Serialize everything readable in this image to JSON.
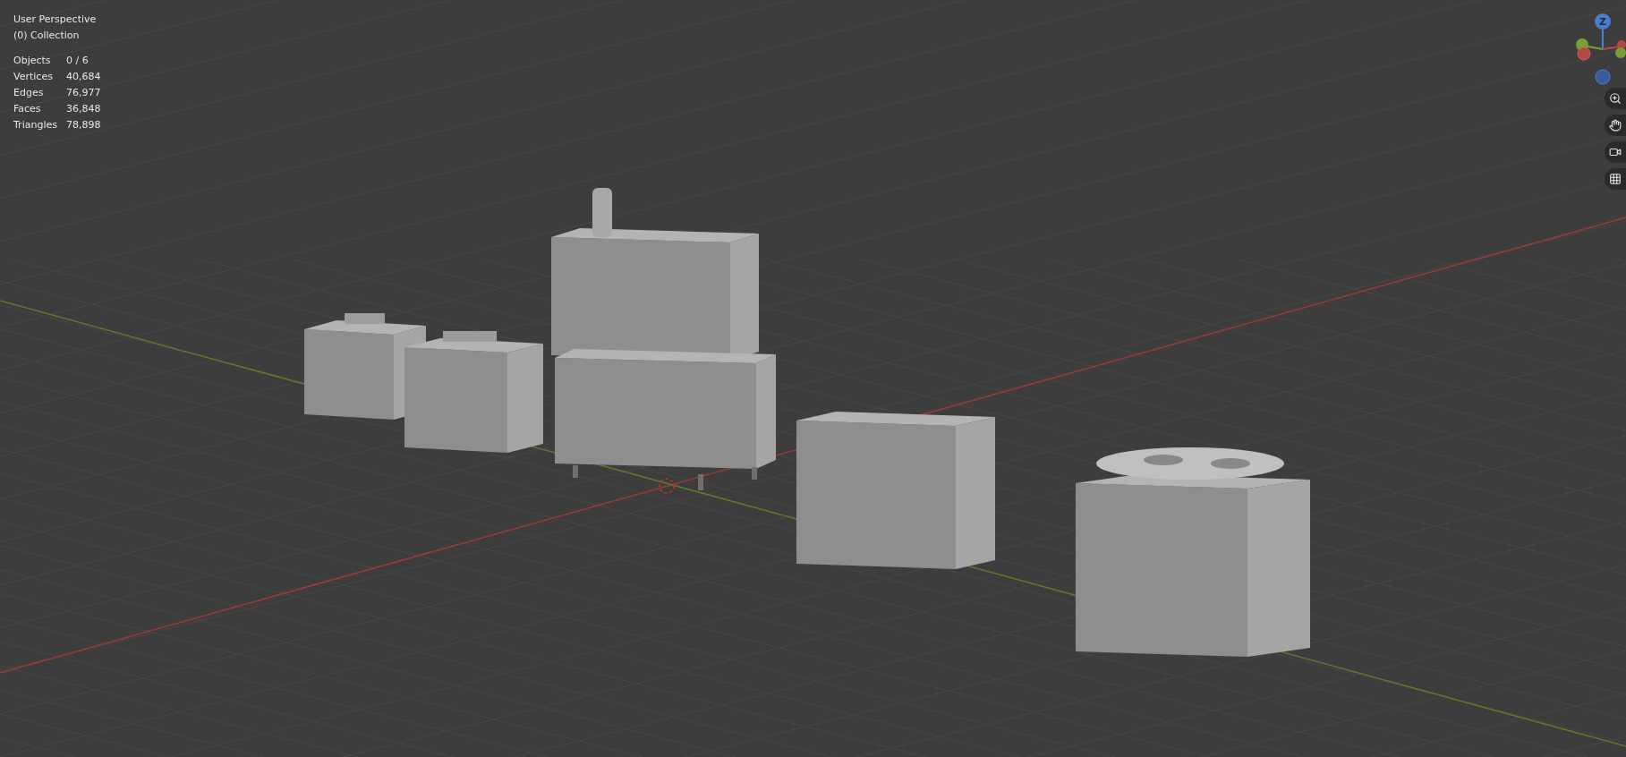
{
  "viewport": {
    "view_name": "User Perspective",
    "collection": "(0) Collection"
  },
  "stats": [
    {
      "label": "Objects",
      "value": "0 / 6"
    },
    {
      "label": "Vertices",
      "value": "40,684"
    },
    {
      "label": "Edges",
      "value": "76,977"
    },
    {
      "label": "Faces",
      "value": "36,848"
    },
    {
      "label": "Triangles",
      "value": "78,898"
    }
  ],
  "gizmo": {
    "axis_label": "Z"
  }
}
